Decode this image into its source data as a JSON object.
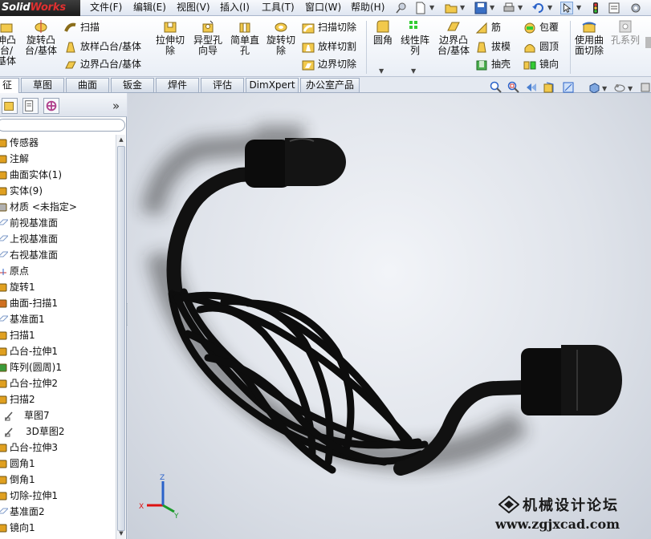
{
  "app": {
    "logo_main": "Solid",
    "logo_accent": "Works"
  },
  "menu": {
    "items": [
      "文件(F)",
      "编辑(E)",
      "视图(V)",
      "插入(I)",
      "工具(T)",
      "窗口(W)",
      "帮助(H)"
    ]
  },
  "commands": {
    "large": [
      {
        "label": "伸凸\n台/基体"
      },
      {
        "label": "旋转凸\n台/基体"
      },
      {
        "label": "拉伸切\n除"
      },
      {
        "label": "异型孔\n向导"
      },
      {
        "label": "简单直\n孔"
      },
      {
        "label": "旋转切\n除"
      },
      {
        "label": "圆角"
      },
      {
        "label": "线性阵\n列"
      },
      {
        "label": "边界凸\n台/基体"
      },
      {
        "label": "使用曲\n面切除"
      },
      {
        "label": "孔系列"
      }
    ],
    "small_group1": [
      "扫描",
      "放样凸台/基体",
      "边界凸台/基体"
    ],
    "small_group2": [
      "扫描切除",
      "放样切割",
      "边界切除"
    ],
    "small_group3": [
      "筋",
      "拔模",
      "抽壳"
    ],
    "small_group4": [
      "包覆",
      "圆顶",
      "镜向"
    ]
  },
  "tabs": [
    "征",
    "草图",
    "曲面",
    "钣金",
    "焊件",
    "评估",
    "DimXpert",
    "办公室产品"
  ],
  "panel": {
    "expand_glyph": "»",
    "tree": [
      {
        "label": "传感器",
        "icon": "sensor-icon"
      },
      {
        "label": "注解",
        "icon": "annotation-icon"
      },
      {
        "label": "曲面实体(1)",
        "icon": "surface-body-icon"
      },
      {
        "label": "实体(9)",
        "icon": "solid-body-icon"
      },
      {
        "label": "材质 <未指定>",
        "icon": "material-icon"
      },
      {
        "label": "前视基准面",
        "icon": "plane-icon"
      },
      {
        "label": "上视基准面",
        "icon": "plane-icon"
      },
      {
        "label": "右视基准面",
        "icon": "plane-icon"
      },
      {
        "label": "原点",
        "icon": "origin-icon"
      },
      {
        "label": "旋转1",
        "icon": "revolve-icon"
      },
      {
        "label": "曲面-扫描1",
        "icon": "surface-sweep-icon"
      },
      {
        "label": "基准面1",
        "icon": "plane-icon"
      },
      {
        "label": "扫描1",
        "icon": "sweep-icon"
      },
      {
        "label": "凸台-拉伸1",
        "icon": "extrude-icon"
      },
      {
        "label": "阵列(圆周)1",
        "icon": "circular-pattern-icon"
      },
      {
        "label": "凸台-拉伸2",
        "icon": "extrude-icon"
      },
      {
        "label": "扫描2",
        "icon": "sweep-icon"
      },
      {
        "label": "草图7",
        "icon": "sketch-icon"
      },
      {
        "label": "3D草图2",
        "icon": "sketch3d-icon"
      },
      {
        "label": "凸台-拉伸3",
        "icon": "extrude-icon"
      },
      {
        "label": "圆角1",
        "icon": "fillet-icon"
      },
      {
        "label": "倒角1",
        "icon": "chamfer-icon"
      },
      {
        "label": "切除-拉伸1",
        "icon": "cut-extrude-icon"
      },
      {
        "label": "基准面2",
        "icon": "plane-icon"
      },
      {
        "label": "镜向1",
        "icon": "mirror-icon"
      }
    ]
  },
  "triad": {
    "x": "X",
    "y": "Y",
    "z": "Z"
  },
  "watermark": {
    "title": "机械设计论坛",
    "url": "www.zgjxcad.com"
  }
}
